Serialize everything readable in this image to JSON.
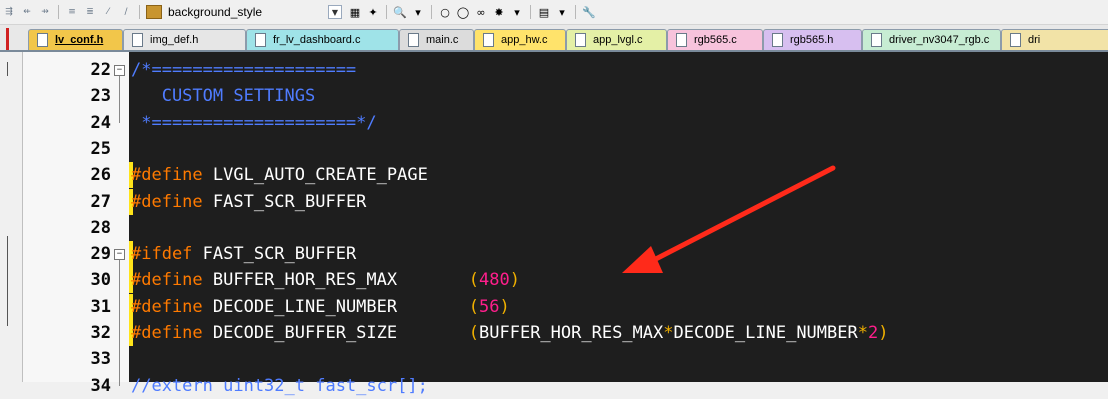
{
  "toolbar": {
    "style_combo_value": "background_style"
  },
  "tabs": [
    {
      "label": "lv_conf.h",
      "bg": "#f2c64a",
      "active": true
    },
    {
      "label": "img_def.h",
      "bg": "#e6e6e6",
      "active": false
    },
    {
      "label": "fr_lv_dashboard.c",
      "bg": "#9fe3e8",
      "active": false
    },
    {
      "label": "main.c",
      "bg": "#dcdcdc",
      "active": false
    },
    {
      "label": "app_hw.c",
      "bg": "#ffe36b",
      "active": false
    },
    {
      "label": "app_lvgl.c",
      "bg": "#e4f0a6",
      "active": false
    },
    {
      "label": "rgb565.c",
      "bg": "#f7c3dc",
      "active": false
    },
    {
      "label": "rgb565.h",
      "bg": "#d7bff0",
      "active": false
    },
    {
      "label": "driver_nv3047_rgb.c",
      "bg": "#c7ecd3",
      "active": false
    },
    {
      "label": "dri",
      "bg": "#f2e3a7",
      "active": false
    }
  ],
  "editor": {
    "lines": [
      {
        "num": "22",
        "tokens": [
          {
            "t": "/*====================",
            "c": "c-comment"
          }
        ]
      },
      {
        "num": "23",
        "tokens": [
          {
            "t": "   CUSTOM SETTINGS",
            "c": "c-comment"
          }
        ]
      },
      {
        "num": "24",
        "tokens": [
          {
            "t": " *====================*/",
            "c": "c-comment"
          }
        ]
      },
      {
        "num": "25",
        "tokens": []
      },
      {
        "num": "26",
        "tokens": [
          {
            "t": "#define",
            "c": "c-kw"
          },
          {
            "t": " LVGL_AUTO_CREATE_PAGE",
            "c": "c-id"
          }
        ]
      },
      {
        "num": "27",
        "tokens": [
          {
            "t": "#define",
            "c": "c-kw"
          },
          {
            "t": " FAST_SCR_BUFFER",
            "c": "c-id"
          }
        ]
      },
      {
        "num": "28",
        "tokens": []
      },
      {
        "num": "29",
        "tokens": [
          {
            "t": "#ifdef",
            "c": "c-kw"
          },
          {
            "t": " FAST_SCR_BUFFER",
            "c": "c-id"
          }
        ]
      },
      {
        "num": "30",
        "tokens": [
          {
            "t": "#define",
            "c": "c-kw"
          },
          {
            "t": " BUFFER_HOR_RES_MAX       ",
            "c": "c-id"
          },
          {
            "t": "(",
            "c": "c-paren"
          },
          {
            "t": "480",
            "c": "c-num"
          },
          {
            "t": ")",
            "c": "c-paren"
          }
        ]
      },
      {
        "num": "31",
        "tokens": [
          {
            "t": "#define",
            "c": "c-kw"
          },
          {
            "t": " DECODE_LINE_NUMBER       ",
            "c": "c-id"
          },
          {
            "t": "(",
            "c": "c-paren"
          },
          {
            "t": "56",
            "c": "c-num"
          },
          {
            "t": ")",
            "c": "c-paren"
          }
        ]
      },
      {
        "num": "32",
        "tokens": [
          {
            "t": "#define",
            "c": "c-kw"
          },
          {
            "t": " DECODE_BUFFER_SIZE       ",
            "c": "c-id"
          },
          {
            "t": "(",
            "c": "c-paren"
          },
          {
            "t": "BUFFER_HOR_RES_MAX",
            "c": "c-id"
          },
          {
            "t": "*",
            "c": "c-op"
          },
          {
            "t": "DECODE_LINE_NUMBER",
            "c": "c-id"
          },
          {
            "t": "*",
            "c": "c-op"
          },
          {
            "t": "2",
            "c": "c-num"
          },
          {
            "t": ")",
            "c": "c-paren"
          }
        ]
      },
      {
        "num": "33",
        "tokens": []
      },
      {
        "num": "34",
        "tokens": [
          {
            "t": "//extern uint32_t fast_scr[];",
            "c": "c-comment"
          }
        ]
      }
    ]
  },
  "colors": {
    "editor_bg": "#1e1e1e",
    "comment": "#4f7cff",
    "keyword": "#ff7a00",
    "number": "#ff1e8c",
    "paren": "#f0b000",
    "arrow": "#ff2a1a"
  }
}
